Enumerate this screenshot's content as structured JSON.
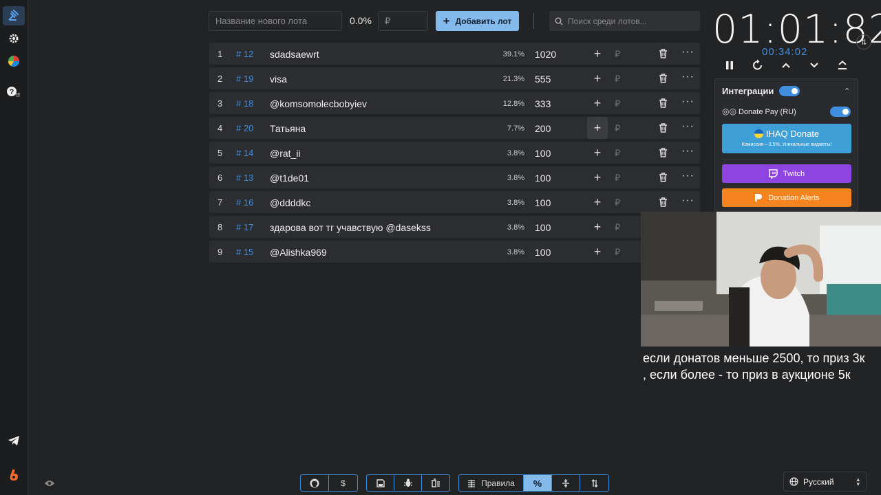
{
  "top": {
    "new_lot_placeholder": "Название нового лота",
    "percent": "0.0%",
    "amount_placeholder": "₽",
    "add_button": "Добавить лот",
    "search_placeholder": "Поиск среди лотов..."
  },
  "lots": [
    {
      "n": "1",
      "id": "# 12",
      "name": "sdadsaewrt",
      "pct": "39.1%",
      "amount": "1020",
      "plus": "+",
      "rub": "₽",
      "more": "···"
    },
    {
      "n": "2",
      "id": "# 19",
      "name": "visa",
      "pct": "21.3%",
      "amount": "555",
      "plus": "+",
      "rub": "₽",
      "more": "···"
    },
    {
      "n": "3",
      "id": "# 18",
      "name": "@komsomolecbobyiev",
      "pct": "12.8%",
      "amount": "333",
      "plus": "+",
      "rub": "₽",
      "more": "···"
    },
    {
      "n": "4",
      "id": "# 20",
      "name": "Татьяна",
      "pct": "7.7%",
      "amount": "200",
      "plus": "+",
      "rub": "₽",
      "more": "···"
    },
    {
      "n": "5",
      "id": "# 14",
      "name": "@rat_ii",
      "pct": "3.8%",
      "amount": "100",
      "plus": "+",
      "rub": "₽",
      "more": "···"
    },
    {
      "n": "6",
      "id": "# 13",
      "name": "@t1de01",
      "pct": "3.8%",
      "amount": "100",
      "plus": "+",
      "rub": "₽",
      "more": "···"
    },
    {
      "n": "7",
      "id": "# 16",
      "name": "@ddddkc",
      "pct": "3.8%",
      "amount": "100",
      "plus": "+",
      "rub": "₽",
      "more": "···"
    },
    {
      "n": "8",
      "id": "# 17",
      "name": "здарова вот тг учавствую @dasekss",
      "pct": "3.8%",
      "amount": "100",
      "plus": "+",
      "rub": "₽",
      "more": "···"
    },
    {
      "n": "9",
      "id": "# 15",
      "name": "@Alishka969",
      "pct": "3.8%",
      "amount": "100",
      "plus": "+",
      "rub": "₽",
      "more": "···"
    }
  ],
  "timer": {
    "main": "01:01:82",
    "sub": "00:34:02"
  },
  "integrations": {
    "title": "Интеграции",
    "donatepay": "Donate Pay (RU)",
    "ihaq_title": "IHAQ Donate",
    "ihaq_sub": "Комиссия – 3,5%. Уникальные виджеты!",
    "twitch": "Twitch",
    "donation_alerts": "Donation Alerts"
  },
  "captions": {
    "line1": "если донатов меньше 2500, то приз 3к",
    "line2": ", если более - то приз в аукционе 5к"
  },
  "bottom": {
    "rules": "Правила",
    "percent_icon": "%",
    "dollar": "$"
  },
  "language": "Русский",
  "colors": {
    "accent": "#3f8ee0",
    "accent_light": "#84b9ec",
    "twitch": "#8d44e0",
    "donation_alerts": "#f5841f",
    "ihaq": "#3d9fd6"
  }
}
